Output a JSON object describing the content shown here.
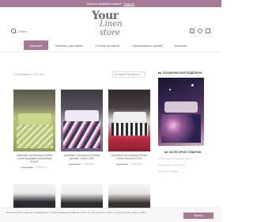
{
  "topbar": {
    "text": "Магазин временно закрыт!",
    "link": "Закрыть"
  },
  "header": {
    "logo_main": "Your",
    "logo_script": "Linen store",
    "search_placeholder": "Поиск",
    "cart_count": "0"
  },
  "nav": {
    "items": [
      {
        "label": "Магазин"
      },
      {
        "label": "Оплата и доставка"
      },
      {
        "label": "Список желаний"
      },
      {
        "label": "Оформление заказа"
      },
      {
        "label": "Корзина"
      }
    ]
  },
  "toolbar": {
    "results": "Отображение 1–9 из 144",
    "sort": "Исходная сортировка"
  },
  "products": [
    {
      "title": "Комплект постельного белья Сатин Вышивка волшебная CH013.",
      "price_old": "3 000,00 ₽",
      "price": "2 500,00 ₽"
    },
    {
      "title": "Комплект постельного белья Делюкс Сатин L201",
      "price_old": "3 000,00 ₽",
      "price": "2 500,00 ₽"
    },
    {
      "title": "Комплект постельного белья Сатин Экстра ST016",
      "price_old": "3 000,00 ₽",
      "price": "2 500,00 ₽"
    }
  ],
  "sidebar": {
    "promo_title": "КОСМИЧЕСКАЯ ПОДБОРКА",
    "cats_title": "КАТЕГОРИИ ТОВАРОВ",
    "cat_lines": [
      "Комплекты постельного белья",
      "Постельное белье сатин",
      "Подушки и одеяла"
    ]
  },
  "cookie": {
    "text": "Используя этот сайт, вы соглашаетесь с использованием файлов cookie. Мы используем cookie, чтобы улучшить работу сайта.",
    "button": "Принять"
  },
  "colors": {
    "accent": "#a67a97"
  }
}
